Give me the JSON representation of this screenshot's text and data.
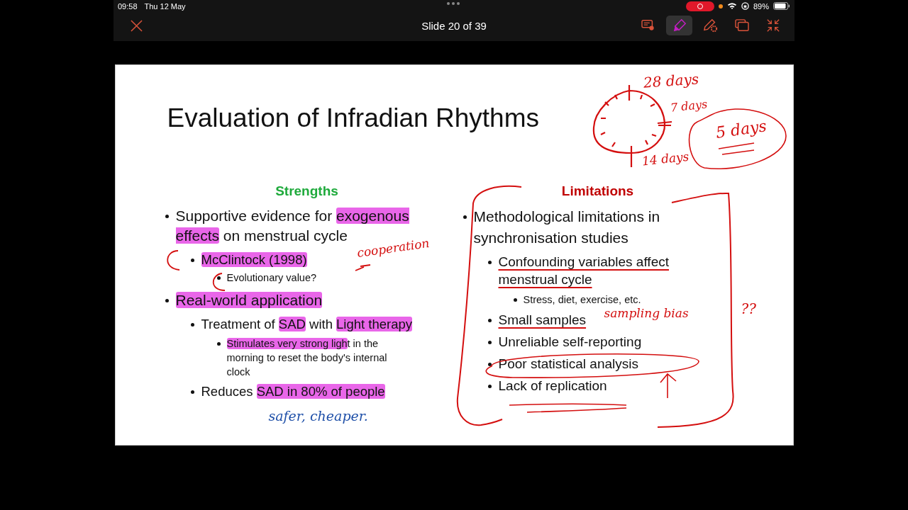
{
  "status_bar": {
    "time": "09:58",
    "date": "Thu 12 May",
    "battery": "89%"
  },
  "toolbar": {
    "title": "Slide 20 of 39",
    "tools": [
      {
        "kind": "comment",
        "selected": false
      },
      {
        "kind": "highlighter",
        "selected": true
      },
      {
        "kind": "pen-settings",
        "selected": false
      },
      {
        "kind": "slides",
        "selected": false
      }
    ]
  },
  "slide": {
    "title": "Evaluation of Infradian Rhythms",
    "strengths": {
      "heading": "Strengths",
      "items": [
        {
          "runs": [
            {
              "text": "Supportive evidence for ",
              "highlighted": false
            },
            {
              "text": "exogenous effects",
              "highlighted": true
            },
            {
              "text": " on menstrual cycle",
              "highlighted": false
            }
          ],
          "children": [
            {
              "runs": [
                {
                  "text": "McClintock (1998)",
                  "highlighted": true
                }
              ],
              "children": [
                {
                  "runs": [
                    {
                      "text": "Evolutionary value?",
                      "highlighted": false
                    }
                  ]
                }
              ]
            }
          ]
        },
        {
          "runs": [
            {
              "text": "Real-world application",
              "highlighted": true
            }
          ],
          "children": [
            {
              "runs": [
                {
                  "text": "Treatment of ",
                  "highlighted": false
                },
                {
                  "text": "SAD",
                  "highlighted": true
                },
                {
                  "text": " with ",
                  "highlighted": false
                },
                {
                  "text": "Light therapy",
                  "highlighted": true
                }
              ],
              "children": [
                {
                  "runs": [
                    {
                      "text": "Stimulates very strong ligh",
                      "highlighted": true
                    },
                    {
                      "text": "t in the morning to reset the body's internal clock",
                      "highlighted": false
                    }
                  ]
                }
              ]
            },
            {
              "runs": [
                {
                  "text": "Reduces ",
                  "highlighted": false
                },
                {
                  "text": "SAD in 80% of people",
                  "highlighted": true
                }
              ]
            }
          ]
        }
      ]
    },
    "limitations": {
      "heading": "Limitations",
      "items": [
        {
          "text": "Methodological limitations in synchronisation studies",
          "underlined": false,
          "children": [
            {
              "text": "Confounding variables affect menstrual cycle",
              "underlined": true,
              "children": [
                {
                  "text": "Stress, diet, exercise, etc.",
                  "underlined": false
                }
              ]
            },
            {
              "text": "Small samples",
              "underlined": true
            },
            {
              "text": "Unreliable self-reporting",
              "underlined": false
            },
            {
              "text": "Poor statistical analysis",
              "underlined": false
            },
            {
              "text": "Lack of replication",
              "underlined": false
            }
          ]
        }
      ]
    }
  },
  "ink_notes": [
    {
      "text": "28 days",
      "color": "#d40f0f"
    },
    {
      "text": "7 days",
      "color": "#d40f0f"
    },
    {
      "text": "5 days",
      "color": "#d40f0f"
    },
    {
      "text": "14 days",
      "color": "#d40f0f"
    },
    {
      "text": "cooperation",
      "color": "#d40f0f"
    },
    {
      "text": "sampling bias",
      "color": "#d40f0f"
    },
    {
      "text": "??",
      "color": "#d40f0f"
    },
    {
      "text": "safer, cheaper.",
      "color": "#1e4fa8"
    }
  ]
}
